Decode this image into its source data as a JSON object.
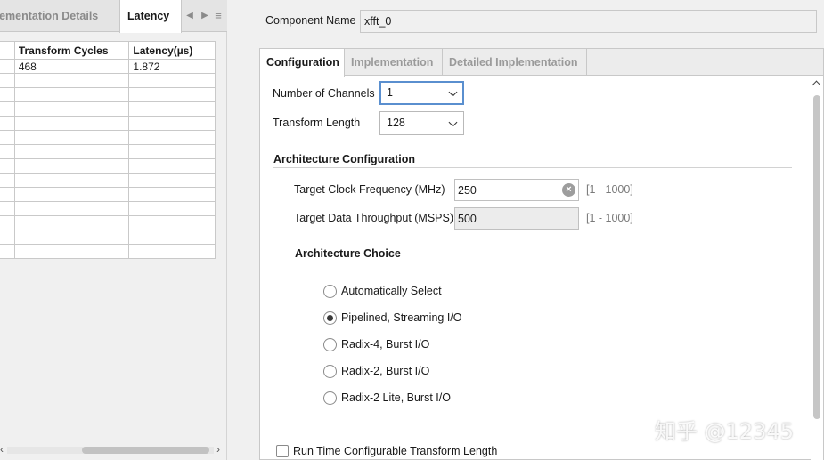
{
  "left_panel": {
    "tabs": {
      "inactive_label": "plementation Details",
      "active_label": "Latency"
    },
    "table": {
      "headers": [
        "",
        "Transform Cycles",
        "Latency(µs)"
      ],
      "rows": [
        [
          "",
          "468",
          "1.872"
        ],
        [
          "",
          "",
          ""
        ],
        [
          "",
          "",
          ""
        ],
        [
          "",
          "",
          ""
        ],
        [
          "",
          "",
          ""
        ],
        [
          "",
          "",
          ""
        ],
        [
          "",
          "",
          ""
        ],
        [
          "",
          "",
          ""
        ],
        [
          "",
          "",
          ""
        ],
        [
          "",
          "",
          ""
        ],
        [
          "",
          "",
          ""
        ],
        [
          "",
          "",
          ""
        ],
        [
          "",
          "",
          ""
        ],
        [
          "",
          "",
          ""
        ]
      ]
    }
  },
  "component": {
    "label": "Component Name",
    "value": "xfft_0"
  },
  "config_tabs": {
    "configuration": "Configuration",
    "implementation": "Implementation",
    "detailed_implementation": "Detailed Implementation"
  },
  "form": {
    "channels_label": "Number of Channels",
    "channels_value": "1",
    "length_label": "Transform Length",
    "length_value": "128",
    "arch_config_title": "Architecture Configuration",
    "clock_label": "Target Clock Frequency (MHz)",
    "clock_value": "250",
    "clock_range": "[1 - 1000]",
    "throughput_label": "Target Data Throughput (MSPS)",
    "throughput_value": "500",
    "throughput_range": "[1 - 1000]",
    "arch_choice_title": "Architecture Choice",
    "arch_options": [
      {
        "label": "Automatically Select",
        "checked": false
      },
      {
        "label": "Pipelined, Streaming I/O",
        "checked": true
      },
      {
        "label": "Radix-4, Burst I/O",
        "checked": false
      },
      {
        "label": "Radix-2, Burst I/O",
        "checked": false
      },
      {
        "label": "Radix-2 Lite, Burst I/O",
        "checked": false
      }
    ],
    "runtime_label": "Run Time Configurable Transform Length"
  },
  "watermark": "知乎 @12345"
}
